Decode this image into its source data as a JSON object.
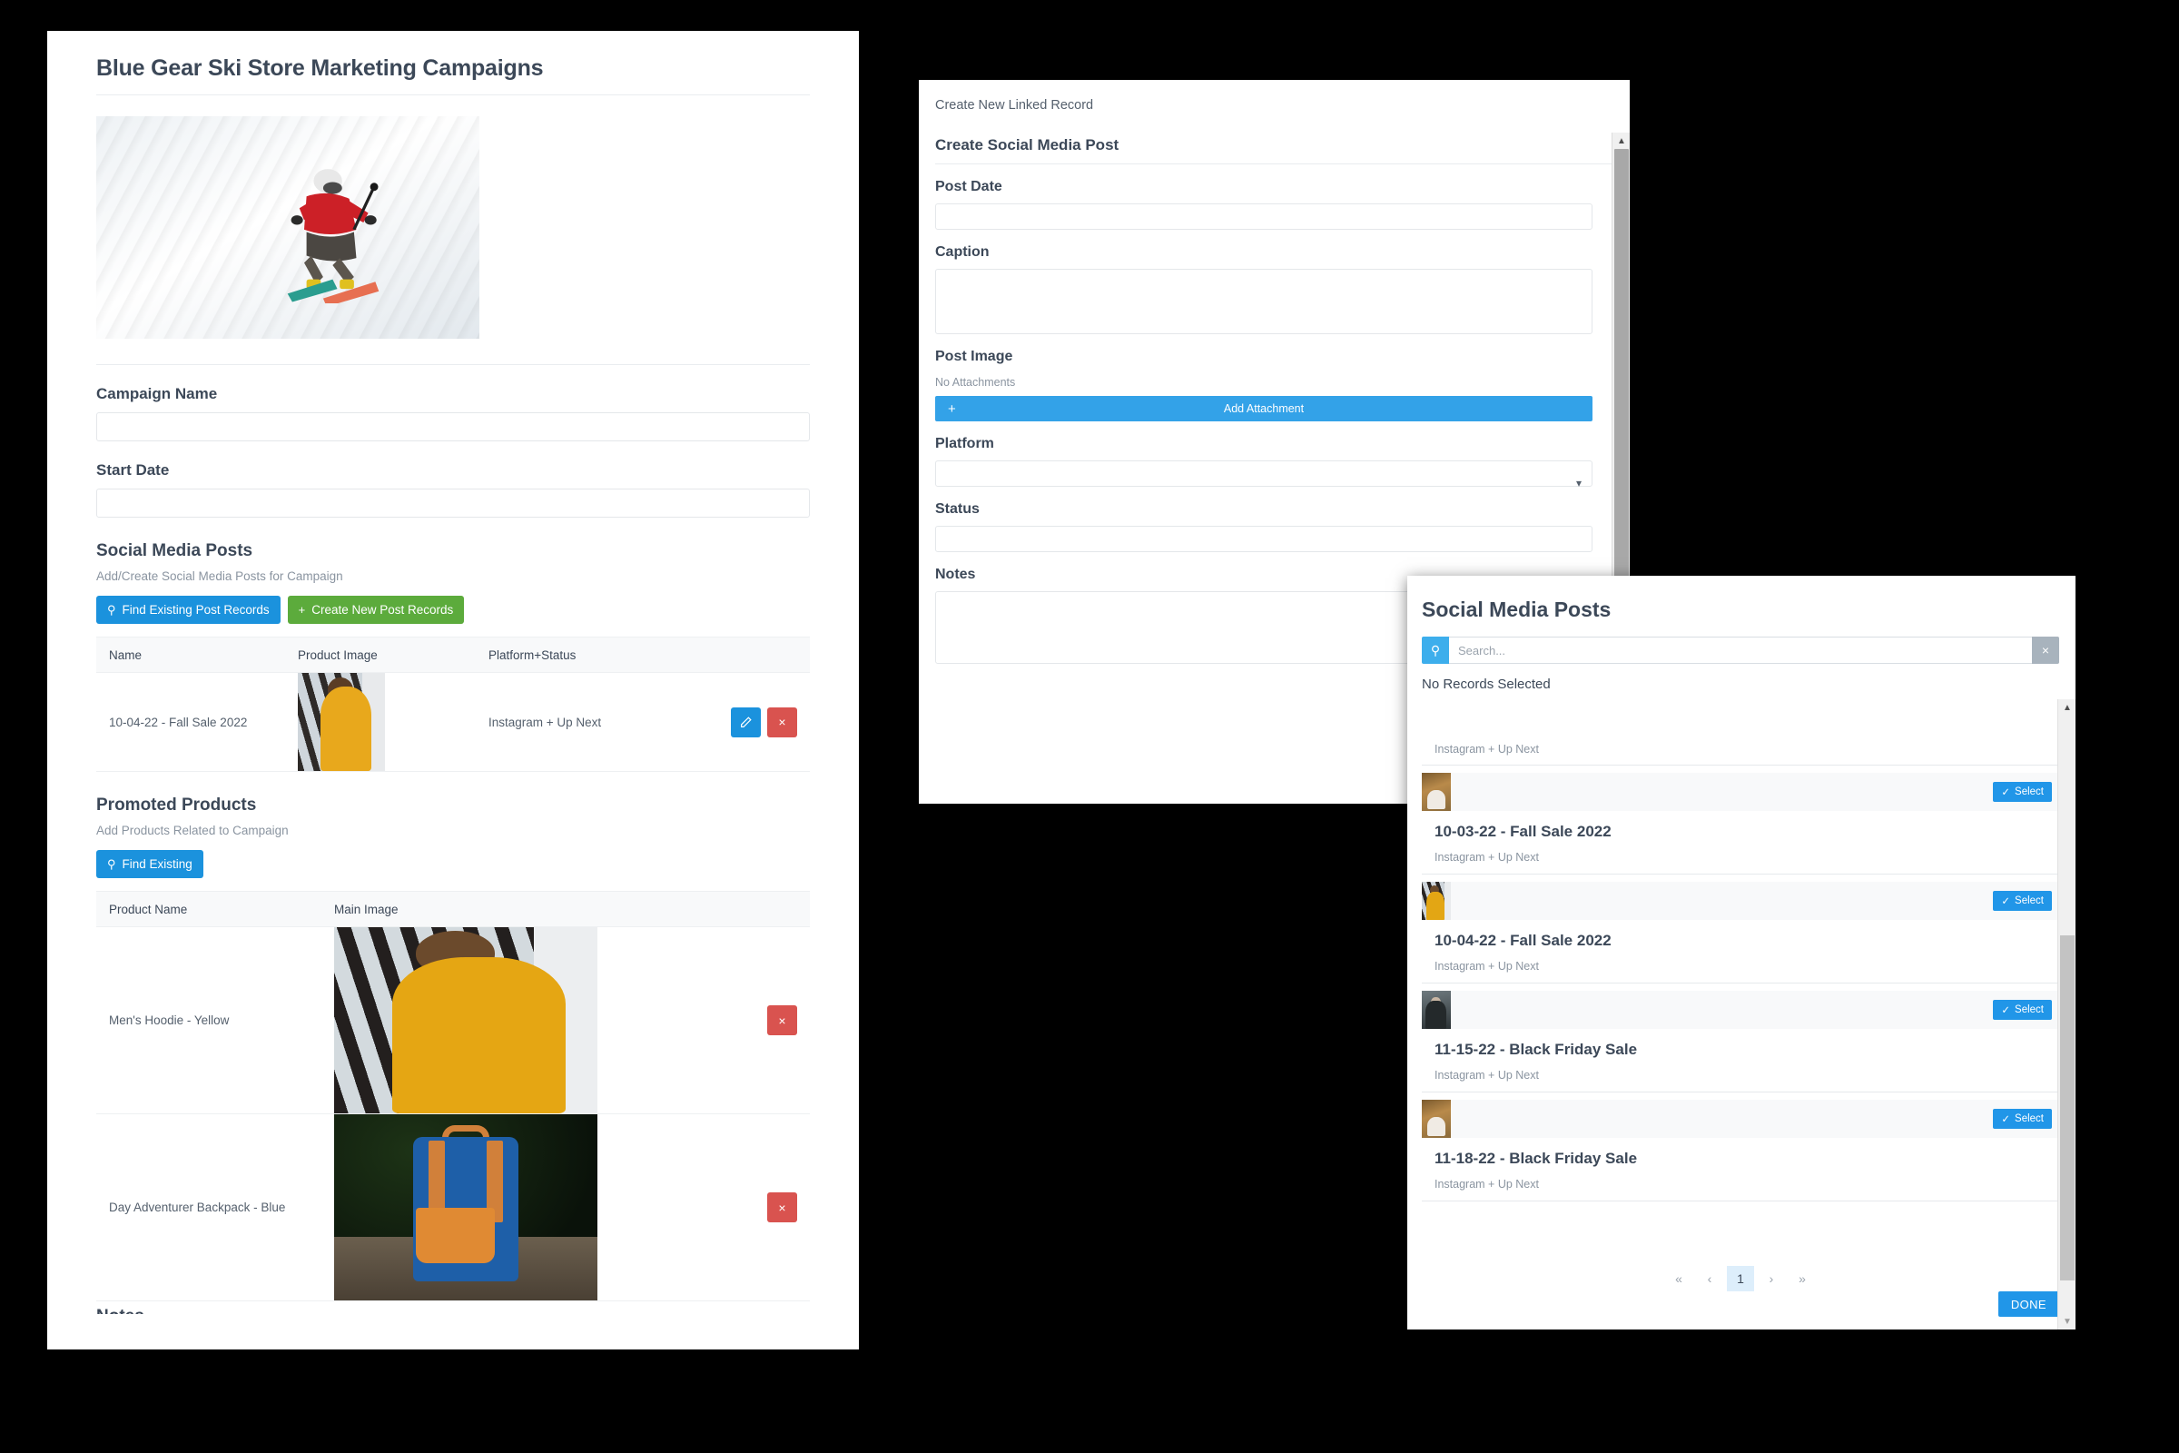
{
  "left_panel": {
    "page_title": "Blue Gear Ski Store Marketing Campaigns",
    "hero_image_alt": "skier-photo",
    "campaign_name": {
      "label": "Campaign Name",
      "value": "",
      "placeholder": ""
    },
    "start_date": {
      "label": "Start Date",
      "value": "",
      "placeholder": ""
    },
    "social_media_posts": {
      "heading": "Social Media Posts",
      "subtitle": "Add/Create Social Media Posts for Campaign",
      "find_button": "Find Existing Post Records",
      "create_button": "Create New Post Records",
      "columns": [
        "Name",
        "Product Image",
        "Platform+Status"
      ],
      "rows": [
        {
          "name": "10-04-22 - Fall Sale 2022",
          "image": "mens-hoodie-yellow-thumb",
          "platform_status": "Instagram + Up Next",
          "edit_label": "✎",
          "delete_label": "×"
        }
      ]
    },
    "promoted_products": {
      "heading": "Promoted Products",
      "subtitle": "Add Products Related to Campaign",
      "find_button": "Find Existing",
      "columns": [
        "Product Name",
        "Main Image"
      ],
      "rows": [
        {
          "name": "Men's Hoodie - Yellow",
          "image": "mens-hoodie-yellow",
          "delete_label": "×"
        },
        {
          "name": "Day Adventurer Backpack - Blue",
          "image": "day-adventurer-backpack-blue",
          "delete_label": "×"
        }
      ]
    },
    "notes_heading": "Notes"
  },
  "middle_panel": {
    "window_title": "Create New Linked Record",
    "form_heading": "Create Social Media Post",
    "fields": {
      "post_date": {
        "label": "Post Date",
        "value": ""
      },
      "caption": {
        "label": "Caption",
        "value": ""
      },
      "post_image": {
        "label": "Post Image",
        "no_attachments": "No Attachments",
        "add_attachment": "Add Attachment",
        "plus": "+"
      },
      "platform": {
        "label": "Platform",
        "value": "",
        "options": [
          ""
        ]
      },
      "status": {
        "label": "Status",
        "value": ""
      },
      "notes": {
        "label": "Notes",
        "value": ""
      }
    }
  },
  "modal": {
    "title": "Social Media Posts",
    "search": {
      "placeholder": "Search...",
      "value": "",
      "icon": "search-icon",
      "clear": "×"
    },
    "selection_status": "No Records Selected",
    "top_meta": "Instagram + Up Next",
    "select_label": "Select",
    "select_check": "✓",
    "records": [
      {
        "title": "10-03-22 - Fall Sale 2022",
        "subtitle": "Instagram + Up Next",
        "thumb": "autumn-photo"
      },
      {
        "title": "10-04-22 - Fall Sale 2022",
        "subtitle": "Instagram + Up Next",
        "thumb": "hoodie-photo"
      },
      {
        "title": "11-15-22 - Black Friday Sale",
        "subtitle": "Instagram + Up Next",
        "thumb": "dark-jacket-photo"
      },
      {
        "title": "11-18-22 - Black Friday Sale",
        "subtitle": "Instagram + Up Next",
        "thumb": "autumn-photo"
      }
    ],
    "pagination": {
      "first": "«",
      "prev": "‹",
      "current": "1",
      "next": "›",
      "last": "»"
    },
    "done_button": "DONE"
  },
  "colors": {
    "primary_blue": "#1b92dd",
    "light_blue": "#2196e8",
    "green": "#5cab3c",
    "red": "#d9534f",
    "text_dark": "#3c4858",
    "text_muted": "#8a94a0"
  }
}
